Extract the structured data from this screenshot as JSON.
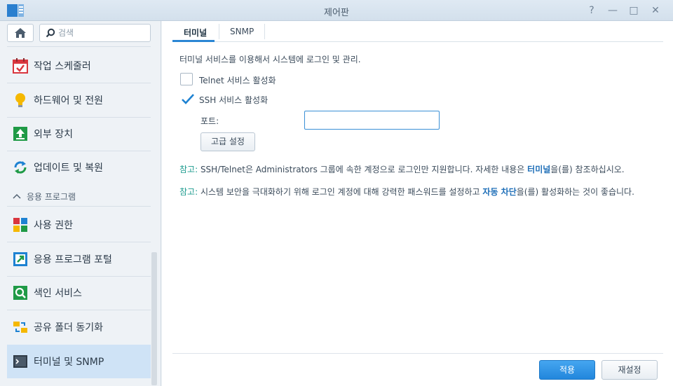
{
  "window": {
    "title": "제어판"
  },
  "window_buttons": [
    "?",
    "—",
    "□",
    "✕"
  ],
  "sidebar": {
    "search_placeholder": "검색",
    "items_top": [
      {
        "label": "작업 스케줄러",
        "icon": "calendar-check-icon"
      },
      {
        "label": "하드웨어 및 전원",
        "icon": "lightbulb-icon"
      },
      {
        "label": "외부 장치",
        "icon": "upload-device-icon"
      },
      {
        "label": "업데이트 및 복원",
        "icon": "refresh-icon"
      }
    ],
    "section_label": "응용 프로그램",
    "items_apps": [
      {
        "label": "사용 권한",
        "icon": "app-grid-icon"
      },
      {
        "label": "응용 프로그램 포털",
        "icon": "portal-arrow-icon"
      },
      {
        "label": "색인 서비스",
        "icon": "magnifier-icon"
      },
      {
        "label": "공유 폴더 동기화",
        "icon": "folder-sync-icon"
      },
      {
        "label": "터미널 및 SNMP",
        "icon": "terminal-icon"
      }
    ]
  },
  "tabs": [
    {
      "label": "터미널",
      "active": true
    },
    {
      "label": "SNMP",
      "active": false
    }
  ],
  "content": {
    "description": "터미널 서비스를 이용해서 시스템에 로그인 및 관리.",
    "telnet_label": "Telnet 서비스 활성화",
    "telnet_checked": false,
    "ssh_label": "SSH 서비스 활성화",
    "ssh_checked": true,
    "port_label": "포트:",
    "port_value": "",
    "advanced_button": "고급 설정",
    "note1": {
      "tag": "참고:",
      "text_before": " SSH/Telnet은 Administrators 그룹에 속한 계정으로 로그인만 지원합니다. 자세한 내용은 ",
      "link": "터미널",
      "text_after": "을(를) 참조하십시오."
    },
    "note2": {
      "tag": "참고:",
      "text_before": " 시스템 보안을 극대화하기 위해 로그인 계정에 대해 강력한 패스워드를 설정하고 ",
      "link": "자동 차단",
      "text_after": "을(를) 활성화하는 것이 좋습니다."
    }
  },
  "footer": {
    "apply_button": "적용",
    "reset_button": "재설정"
  },
  "colors": {
    "accent": "#2286dc",
    "active_item_bg": "#cfe3f6",
    "note_tag": "#1c9b8e",
    "link": "#1f6fb8"
  }
}
